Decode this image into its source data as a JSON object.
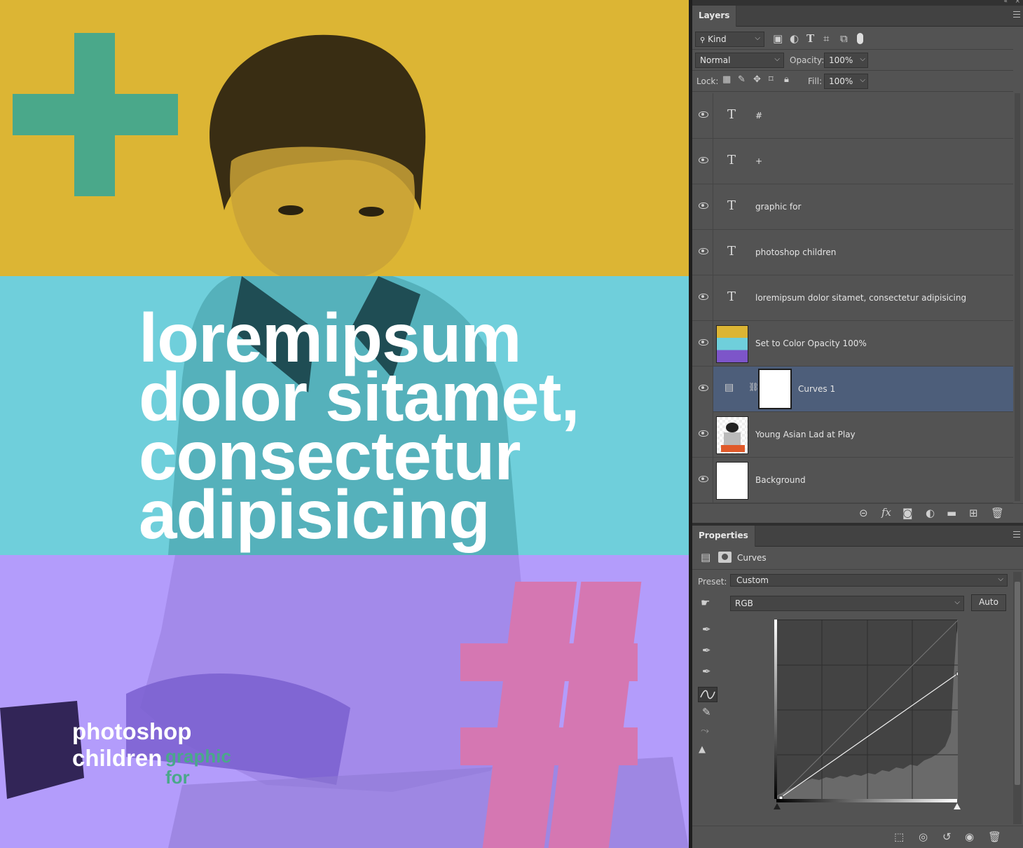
{
  "canvas": {
    "headline": [
      "loremipsum",
      "dolor sitamet,",
      "consectetur",
      "adipisicing"
    ],
    "caption_white": [
      "photoshop",
      "children"
    ],
    "caption_green": [
      "graphic",
      "for"
    ],
    "colors": {
      "yellow": "#dcb534",
      "cyan": "#6fcfdb",
      "purple": "#b39cfb",
      "green": "#4aa88a",
      "pink": "#d577b2"
    }
  },
  "layers_panel": {
    "tab": "Layers",
    "filter_kind": "Kind",
    "blend_mode": "Normal",
    "opacity_label": "Opacity:",
    "opacity_value": "100%",
    "lock_label": "Lock:",
    "fill_label": "Fill:",
    "fill_value": "100%",
    "layers": [
      {
        "name": "#",
        "type": "text"
      },
      {
        "name": "+",
        "type": "text"
      },
      {
        "name": "graphic for",
        "type": "text"
      },
      {
        "name": "photoshop children",
        "type": "text"
      },
      {
        "name": "loremipsum dolor sitamet, consectetur adipisicing",
        "type": "text"
      },
      {
        "name": "Set to Color Opacity 100%",
        "type": "color-fill"
      },
      {
        "name": "Curves 1",
        "type": "adjustment",
        "selected": true
      },
      {
        "name": "Young Asian Lad at Play",
        "type": "image"
      },
      {
        "name": "Background",
        "type": "background"
      }
    ]
  },
  "properties_panel": {
    "tab": "Properties",
    "title": "Curves",
    "preset_label": "Preset:",
    "preset_value": "Custom",
    "channel": "RGB",
    "auto_button": "Auto"
  }
}
